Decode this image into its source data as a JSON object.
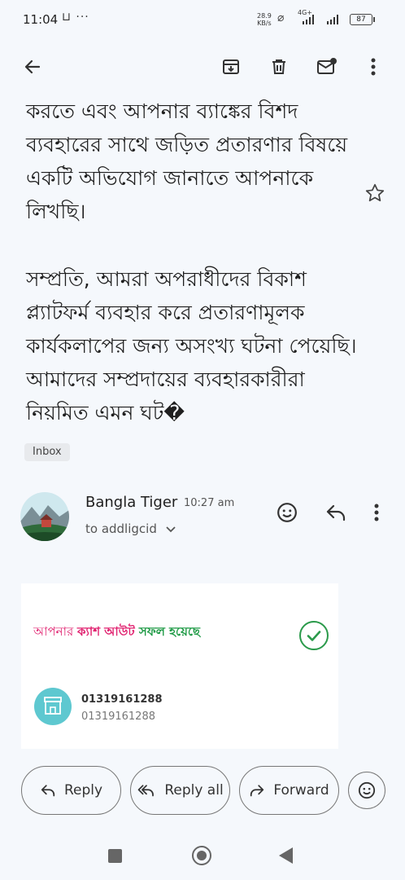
{
  "status_bar": {
    "time": "11:04",
    "left_icons": "⊔ ···",
    "net_speed": "28.9",
    "net_speed_unit": "KB/s",
    "network": "4G+",
    "battery": "87"
  },
  "toolbar": {
    "back_icon": "arrow-left",
    "archive_icon": "archive",
    "delete_icon": "trash",
    "mark_unread_icon": "mail-unread",
    "more_icon": "more-vert"
  },
  "email_body": {
    "para1": "করতে এবং আপনার ব্যাঙ্কের বিশদ ব্যবহারের সাথে জড়িত প্রতারণার বিষয়ে একটি অভিযোগ জানাতে আপনাকে লিখছি।",
    "para2": "সম্প্রতি, আমরা অপরাধীদের বিকাশ প্ল্যাটফর্ম ব্যবহার করে প্রতারণামূলক কার্যকলাপের জন্য অসংখ্য ঘটনা পেয়েছি। আমাদের সম্প্রদায়ের ব্যবহারকারীরা নিয়মিত এমন ঘট�"
  },
  "label_chip": "Inbox",
  "sender": {
    "name": "Bangla Tiger",
    "time": "10:27 am",
    "to": "to addligcid"
  },
  "card": {
    "text_part1": "আপনার ",
    "text_part2": "ক্যাশ আউট ",
    "text_part3": "সফল হয়েছে",
    "number1": "01319161288",
    "number2": "01319161288"
  },
  "actions": {
    "reply": "Reply",
    "reply_all": "Reply all",
    "forward": "Forward"
  },
  "colors": {
    "background": "#f5f8fc",
    "accent_pink": "#e0216f",
    "accent_green": "#1e9a45"
  }
}
